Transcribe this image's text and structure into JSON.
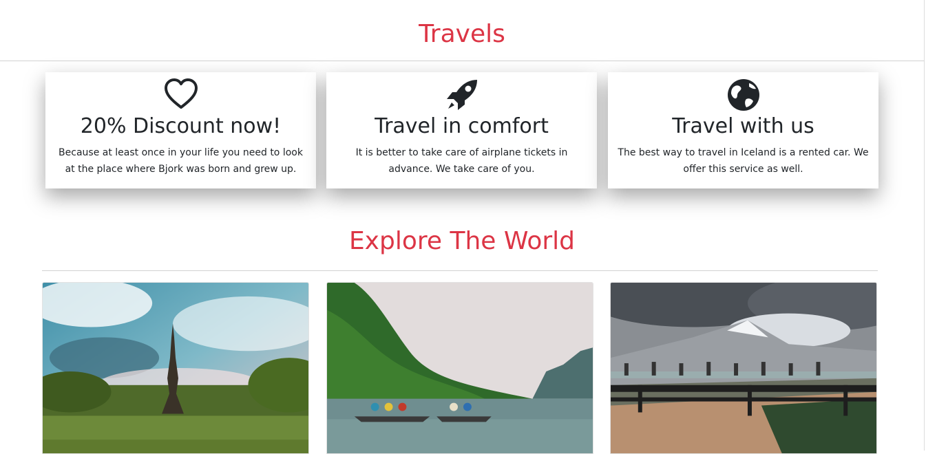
{
  "travels_section": {
    "title": "Travels",
    "cards": [
      {
        "icon": "heart-outline-icon",
        "heading": "20% Discount now!",
        "text": "Because at least once in your life you need to look at the place where Bjork was born and grew up."
      },
      {
        "icon": "rocket-icon",
        "heading": "Travel in comfort",
        "text": "It is better to take care of airplane tickets in advance. We take care of you."
      },
      {
        "icon": "globe-icon",
        "heading": "Travel with us",
        "text": "The best way to travel in Iceland is a rented car. We offer this service as well."
      }
    ]
  },
  "explore_section": {
    "title": "Explore The World",
    "photos": [
      "eiffel-tower-photo",
      "river-boats-photo",
      "glacier-skywalk-photo"
    ]
  },
  "colors": {
    "accent": "#dc3545",
    "text": "#212529"
  }
}
